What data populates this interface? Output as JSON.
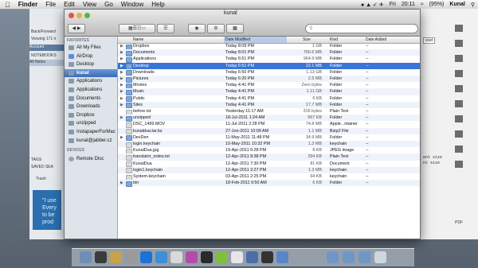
{
  "menubar": {
    "items": [
      "Finder",
      "File",
      "Edit",
      "View",
      "Go",
      "Window",
      "Help"
    ],
    "clock": "20:11",
    "user": "Kunal",
    "battery": "(95%)",
    "day": "Fri"
  },
  "window": {
    "title": "kunal",
    "search_placeholder": ""
  },
  "sidebar": {
    "favorites_label": "FAVORITES",
    "devices_label": "DEVICES",
    "favorites": [
      {
        "label": "All My Files",
        "icon": "all-files-icon",
        "color": "#8a98ab"
      },
      {
        "label": "AirDrop",
        "icon": "airdrop-icon",
        "color": "#5c8fd6"
      },
      {
        "label": "Desktop",
        "icon": "desktop-icon",
        "color": "#8a98ab"
      },
      {
        "label": "kunal",
        "icon": "home-icon",
        "color": "#8a98ab",
        "selected": true
      },
      {
        "label": "Applications",
        "icon": "applications-icon",
        "color": "#8a98ab"
      },
      {
        "label": "Applications",
        "icon": "applications-icon",
        "color": "#8a98ab"
      },
      {
        "label": "Documents",
        "icon": "documents-icon",
        "color": "#8a98ab"
      },
      {
        "label": "Downloads",
        "icon": "downloads-icon",
        "color": "#8a98ab"
      },
      {
        "label": "Dropbox",
        "icon": "folder-icon",
        "color": "#8a98ab"
      },
      {
        "label": "unzipped",
        "icon": "folder-icon",
        "color": "#8a98ab"
      },
      {
        "label": "InstapaperForMac",
        "icon": "folder-icon",
        "color": "#8a98ab"
      },
      {
        "label": "kunal@jabber.cz",
        "icon": "folder-icon",
        "color": "#8a98ab"
      }
    ],
    "devices": [
      {
        "label": "Remote Disc",
        "icon": "disc-icon",
        "color": "#9aa3ad"
      }
    ]
  },
  "columns": {
    "name": "Name",
    "date": "Date Modified",
    "size": "Size",
    "kind": "Kind",
    "added": "Date Added"
  },
  "files": [
    {
      "name": "Dropbox",
      "date": "Today 8:09 PM",
      "size": "1 GB",
      "kind": "Folder",
      "added": "--",
      "folder": true
    },
    {
      "name": "Documents",
      "date": "Today 8:01 PM",
      "size": "766.6 MB",
      "kind": "Folder",
      "added": "--",
      "folder": true
    },
    {
      "name": "Applications",
      "date": "Today 6:51 PM",
      "size": "964.9 MB",
      "kind": "Folder",
      "added": "--",
      "folder": true
    },
    {
      "name": "Desktop",
      "date": "Today 6:51 PM",
      "size": "22.1 MB",
      "kind": "Folder",
      "added": "--",
      "folder": true,
      "selected": true
    },
    {
      "name": "Downloads",
      "date": "Today 6:50 PM",
      "size": "1.13 GB",
      "kind": "Folder",
      "added": "--",
      "folder": true
    },
    {
      "name": "Pictures",
      "date": "Today 6:20 PM",
      "size": "2.5 MB",
      "kind": "Folder",
      "added": "--",
      "folder": true
    },
    {
      "name": "Movies",
      "date": "Today 4:41 PM",
      "size": "Zero bytes",
      "kind": "Folder",
      "added": "--",
      "folder": true
    },
    {
      "name": "Music",
      "date": "Today 4:41 PM",
      "size": "1.11 GB",
      "kind": "Folder",
      "added": "--",
      "folder": true
    },
    {
      "name": "Public",
      "date": "Today 4:41 PM",
      "size": "6 KB",
      "kind": "Folder",
      "added": "--",
      "folder": true
    },
    {
      "name": "Sites",
      "date": "Today 4:41 PM",
      "size": "17.7 MB",
      "kind": "Folder",
      "added": "--",
      "folder": true
    },
    {
      "name": "before.txt",
      "date": "Yesterday 11:17 AM",
      "size": "316 bytes",
      "kind": "Plain Text",
      "added": "--",
      "folder": false
    },
    {
      "name": "unzipped",
      "date": "18-Jul-2011 1:24 AM",
      "size": "567 KB",
      "kind": "Folder",
      "added": "--",
      "folder": true
    },
    {
      "name": "DSC_1499.MOV",
      "date": "11-Jul-2011 2:28 PM",
      "size": "74.8 MB",
      "kind": "Apple...ntainer",
      "added": "--",
      "folder": false
    },
    {
      "name": "kunaldua.tar.bz",
      "date": "27-Jun-2011 10:09 AM",
      "size": "1.1 MB",
      "kind": "Bzip2 File",
      "added": "--",
      "folder": false
    },
    {
      "name": "DevDen",
      "date": "11-May-2011 11:48 PM",
      "size": "34.9 MB",
      "kind": "Folder",
      "added": "--",
      "folder": true
    },
    {
      "name": "login.keychain",
      "date": "10-May-2011 10:32 PM",
      "size": "1.3 MB",
      "kind": "keychain",
      "added": "--",
      "folder": false
    },
    {
      "name": "KunalDua.jpg",
      "date": "19-Apr-2011 6:28 PM",
      "size": "8 KB",
      "kind": "JPEG image",
      "added": "--",
      "folder": false
    },
    {
      "name": "translator_notes.txt",
      "date": "12-Apr-2011 8:38 PM",
      "size": "294 KB",
      "kind": "Plain Text",
      "added": "--",
      "folder": false
    },
    {
      "name": "KunalDua",
      "date": "12-Apr-2011 7:30 PM",
      "size": "81 KB",
      "kind": "Document",
      "added": "--",
      "folder": false
    },
    {
      "name": "login1.keychain",
      "date": "12-Apr-2011 2:27 PM",
      "size": "1.3 MB",
      "kind": "keychain",
      "added": "--",
      "folder": false
    },
    {
      "name": "System.keychain",
      "date": "03-Apr-2011 2:25 PM",
      "size": "64 KB",
      "kind": "keychain",
      "added": "--",
      "folder": false
    },
    {
      "name": "bin",
      "date": "18-Feb-2011 9:50 AM",
      "size": "6 KB",
      "kind": "Folder",
      "added": "--",
      "folder": true
    }
  ],
  "left_app": {
    "back_forward": "Back/Forward",
    "viewing": "Viewing 171 n",
    "account": "Account",
    "notebooks": "NOTEBOOKS",
    "all_notes": "All Notes",
    "tags": "TAGS",
    "saved": "SAVED SEA",
    "trash": "Trash",
    "quote": "\"I use Every to be prod"
  },
  "right_app": {
    "reset": "eset",
    "code1": "ent size",
    "code2": "nt size",
    "pdf": "PDF"
  },
  "colors": {
    "selection": "#3875d7",
    "folder": "#7ea6d8",
    "file": "#d9d9d9",
    "sidebar": "#dee4ea"
  }
}
